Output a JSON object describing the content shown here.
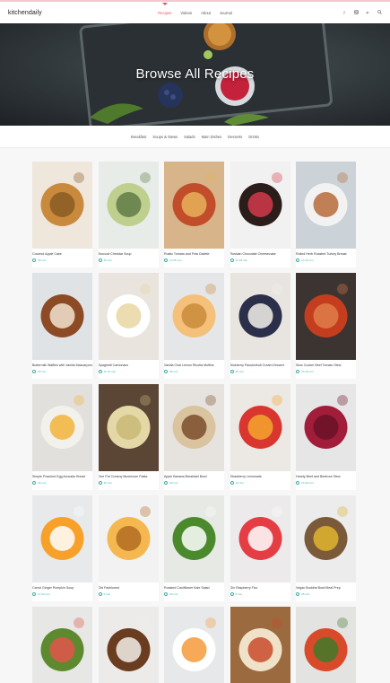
{
  "header": {
    "logo_part1": "kitchen",
    "logo_part2": "daily",
    "nav": [
      "Recipes",
      "Videos",
      "About",
      "Journal"
    ],
    "social_icons": [
      "facebook-icon",
      "instagram-icon",
      "pinterest-icon",
      "search-icon"
    ]
  },
  "hero": {
    "title": "Browse All Recipes"
  },
  "categories": [
    "Breakfast",
    "Soups & Stews",
    "Salads",
    "Main Dishes",
    "Desserts",
    "Drinks"
  ],
  "colors": {
    "accent": "#e0566b",
    "meta": "#43b3a8"
  },
  "recipes": [
    {
      "title": "Coconut Apple Cake",
      "time": "40 min"
    },
    {
      "title": "Broccoli Cheddar Soup",
      "time": "30 min"
    },
    {
      "title": "Rustic Tomato and Feta Galette",
      "time": "1h 05 min"
    },
    {
      "title": "Russian Chocolate Cheesecake",
      "time": "1h 45 min"
    },
    {
      "title": "Rolled Herb Roasted Turkey Breast",
      "time": "1h 15 min"
    },
    {
      "title": "Buttermilk Waffles with Vanilla Mascarpone",
      "time": "30 min"
    },
    {
      "title": "Spaghetti Carbonara",
      "time": "1h 10 min"
    },
    {
      "title": "Vanilla Chai Lemon Ricotta Muffins",
      "time": "35 min"
    },
    {
      "title": "Blueberry Passionfruit Cream Dessert",
      "time": "25 min"
    },
    {
      "title": "Slow Cooker Beef Tomato Stew",
      "time": "2h 40 min"
    },
    {
      "title": "Simple Poached Egg Avocado Bread",
      "time": "25 min"
    },
    {
      "title": "One Pot Creamy Mushroom Pasta",
      "time": "30 min"
    },
    {
      "title": "Apple Banana Breakfast Bowl",
      "time": "20 min"
    },
    {
      "title": "Strawberry Lemonade",
      "time": "10 min"
    },
    {
      "title": "Hearty Beef and Beetroot Stew",
      "time": "1h 40 min"
    },
    {
      "title": "Carrot Ginger Pumpkin Soup",
      "time": "1h 10 min"
    },
    {
      "title": "Old Fashioned",
      "time": "5 min"
    },
    {
      "title": "Roasted Cauliflower Kale Salad",
      "time": "40 min"
    },
    {
      "title": "Gin Raspberry Fizz",
      "time": "5 min"
    },
    {
      "title": "Vegan Buddha Bowl Meal Prep",
      "time": "45 min"
    },
    {
      "title": "",
      "time": ""
    },
    {
      "title": "",
      "time": ""
    },
    {
      "title": "",
      "time": ""
    },
    {
      "title": "",
      "time": ""
    },
    {
      "title": "",
      "time": ""
    }
  ]
}
